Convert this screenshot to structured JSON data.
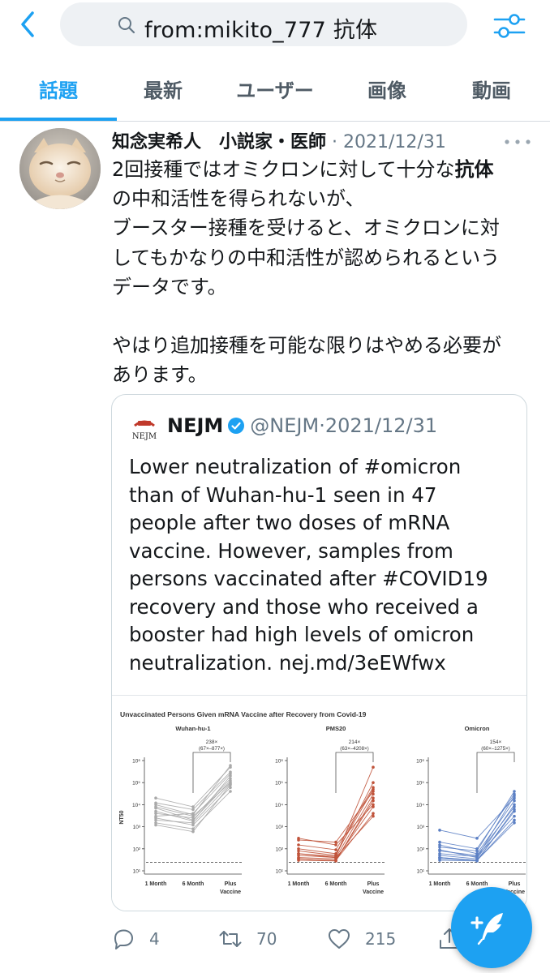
{
  "search": {
    "query": "from:mikito_777 抗体"
  },
  "tabs": [
    {
      "label": "話題",
      "active": true
    },
    {
      "label": "最新",
      "active": false
    },
    {
      "label": "ユーザー",
      "active": false
    },
    {
      "label": "画像",
      "active": false
    },
    {
      "label": "動画",
      "active": false
    }
  ],
  "tweet": {
    "author": "知念実希人　小説家・医師",
    "separator": "·",
    "date": "2021/12/31",
    "body": {
      "line1_pre": "2回接種ではオミクロンに対して十分な",
      "line1_bold": "抗体",
      "line2": "の中和活性を得られないが、",
      "line3": "ブースター接種を受けると、オミクロンに対",
      "line4": "してもかなりの中和活性が認められるという",
      "line5": "データです。",
      "line6": "やはり追加接種を可能な限りはやめる必要が",
      "line7": "あります。"
    },
    "quote": {
      "logo_text": "NEJM",
      "name": "NEJM",
      "handle": "@NEJM",
      "separator": "·",
      "date": "2021/12/31",
      "lines": [
        "Lower neutralization of #omicron",
        "than of Wuhan-hu-1 seen in 47",
        "people after two doses of mRNA",
        "vaccine. However, samples from",
        "persons vaccinated after #COVID19",
        "recovery and those who received a",
        "booster had high levels of omicron",
        "neutralization. nej.md/3eEWfwx"
      ]
    }
  },
  "chart_data": {
    "type": "line",
    "title": "Unvaccinated Persons Given mRNA Vaccine after Recovery from Covid-19",
    "ylabel": "NT50",
    "yscale": "log",
    "ylim": [
      10,
      1000000
    ],
    "y_ticks": [
      "10¹",
      "10²",
      "10³",
      "10⁴",
      "10⁵",
      "10⁶"
    ],
    "categories": [
      "1 Month",
      "6 Month",
      "Plus Vaccine"
    ],
    "panels": [
      {
        "name": "Wuhan-hu-1",
        "fold_change": "238×",
        "ci": "(67×–877×)",
        "color": "#a9a9a9",
        "lines": [
          [
            8000,
            3000,
            100000
          ],
          [
            5000,
            1800,
            200000
          ],
          [
            12000,
            6000,
            300000
          ],
          [
            2500,
            1200,
            60000
          ],
          [
            4000,
            2500,
            150000
          ],
          [
            20000,
            8000,
            500000
          ],
          [
            1500,
            800,
            40000
          ],
          [
            3000,
            4000,
            250000
          ],
          [
            7000,
            2000,
            120000
          ],
          [
            1200,
            600,
            80000
          ],
          [
            10000,
            3500,
            600000
          ],
          [
            2000,
            1500,
            90000
          ]
        ]
      },
      {
        "name": "PMS20",
        "fold_change": "214×",
        "ci": "(63×–4208×)",
        "color": "#c0533a",
        "lines": [
          [
            300,
            150,
            10000
          ],
          [
            60,
            40,
            30000
          ],
          [
            35,
            30,
            4000
          ],
          [
            100,
            60,
            50000
          ],
          [
            40,
            35,
            8000
          ],
          [
            250,
            200,
            40000
          ],
          [
            30,
            28,
            20000
          ],
          [
            80,
            50,
            100000
          ],
          [
            50,
            40,
            3000
          ],
          [
            150,
            90,
            60000
          ],
          [
            35,
            30,
            15000
          ],
          [
            60,
            45,
            500000
          ]
        ]
      },
      {
        "name": "Omicron",
        "fold_change": "154×",
        "ci": "(60×–1275×)",
        "color": "#5b7fc4",
        "lines": [
          [
            80,
            50,
            8000
          ],
          [
            40,
            30,
            5000
          ],
          [
            200,
            100,
            30000
          ],
          [
            60,
            45,
            3000
          ],
          [
            35,
            30,
            1500
          ],
          [
            120,
            80,
            40000
          ],
          [
            50,
            35,
            10000
          ],
          [
            700,
            300,
            20000
          ],
          [
            40,
            30,
            2000
          ],
          [
            150,
            60,
            15000
          ],
          [
            30,
            28,
            6000
          ],
          [
            90,
            40,
            25000
          ]
        ]
      }
    ]
  },
  "actions": {
    "replies": "4",
    "retweets": "70",
    "likes": "215"
  }
}
